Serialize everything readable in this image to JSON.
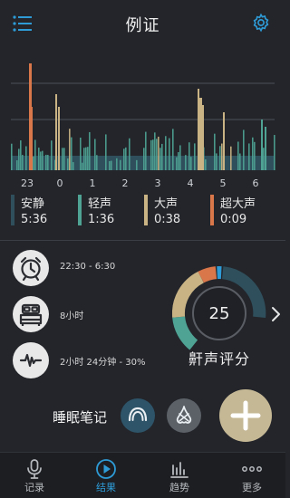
{
  "header": {
    "title": "例证",
    "menu_icon": "menu-icon",
    "settings_icon": "gear-icon"
  },
  "chart": {
    "hour_labels": [
      "23",
      "0",
      "1",
      "2",
      "3",
      "4",
      "5",
      "6"
    ],
    "colors": {
      "quiet": "#2f4f5c",
      "light": "#4ea394",
      "loud": "#c9b384",
      "very_loud": "#d9764a",
      "grid": "#5d6168"
    }
  },
  "legend": [
    {
      "name": "安静",
      "duration": "5:36",
      "color": "#2f4f5c"
    },
    {
      "name": "轻声",
      "duration": "1:36",
      "color": "#4ea394"
    },
    {
      "name": "大声",
      "duration": "0:38",
      "color": "#c9b384"
    },
    {
      "name": "超大声",
      "duration": "0:09",
      "color": "#d9764a"
    }
  ],
  "info": {
    "time_range": "22:30 - 6:30",
    "sleep_duration": "8小时",
    "snore_duration": "2小时 24分钟 - 30%"
  },
  "score": {
    "value": "25",
    "label": "鼾声评分"
  },
  "notes": {
    "label": "睡眠笔记",
    "mouthguard_icon": "mouthguard-icon",
    "nose-strip_icon": "nose-icon",
    "add_icon": "plus-icon"
  },
  "nav": {
    "tabs": [
      {
        "label": "记录",
        "icon": "microphone-icon"
      },
      {
        "label": "结果",
        "icon": "play-icon"
      },
      {
        "label": "趋势",
        "icon": "bars-icon"
      },
      {
        "label": "更多",
        "icon": "more-dots-icon"
      }
    ],
    "active": "结果"
  }
}
